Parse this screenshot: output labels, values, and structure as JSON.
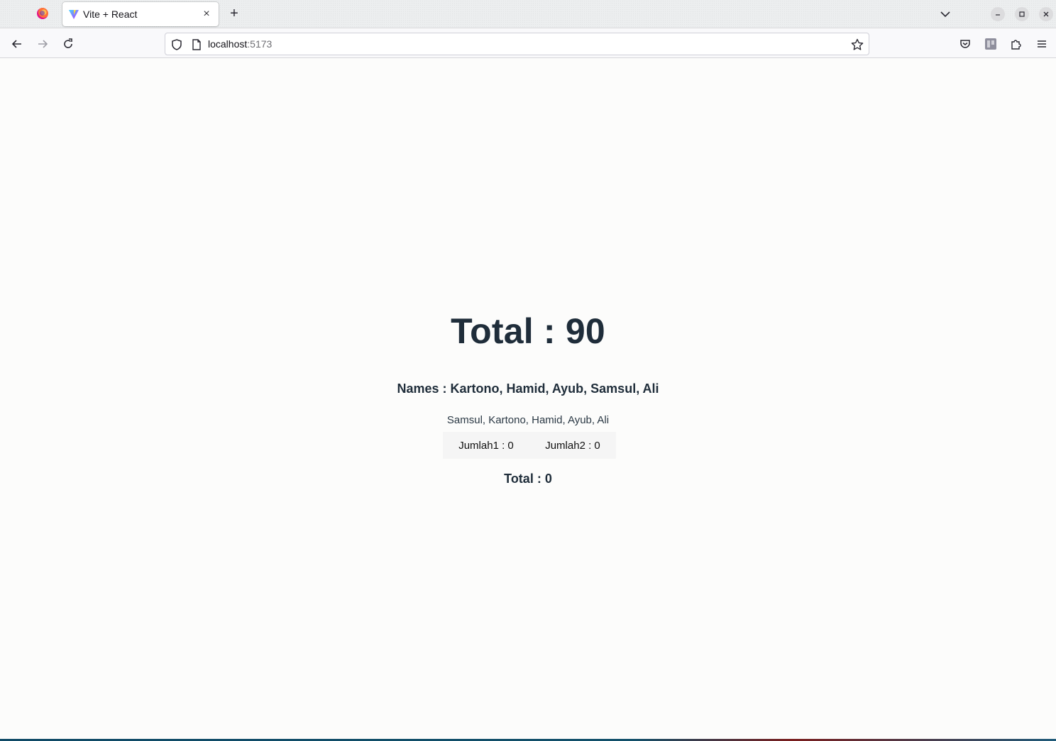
{
  "browser": {
    "tab": {
      "title": "Vite + React",
      "close_glyph": "×"
    },
    "new_tab_glyph": "+",
    "url": {
      "host": "localhost",
      "port": ":5173"
    }
  },
  "page": {
    "total_heading": "Total : 90",
    "names_heading": "Names : Kartono, Hamid, Ayub, Samsul, Ali",
    "names_list": "Samsul, Kartono, Hamid, Ayub, Ali",
    "jumlah1": "Jumlah1 : 0",
    "jumlah2": "Jumlah2 : 0",
    "total_sub": "Total : 0"
  }
}
